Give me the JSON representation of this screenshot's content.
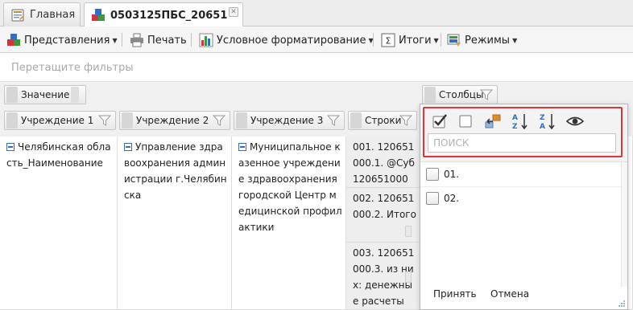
{
  "tabs": [
    {
      "label": "Главная"
    },
    {
      "label": "0503125ПБС_20651"
    }
  ],
  "toolbar": {
    "views": "Представления",
    "print": "Печать",
    "conditional": "Условное форматирование",
    "totals": "Итоги",
    "modes": "Режимы"
  },
  "filter_hint": "Перетащите фильтры",
  "fields": {
    "value": "Значение",
    "columns": "Столбцы",
    "row1": "Учреждение 1",
    "row2": "Учреждение 2",
    "row3": "Учреждение 3",
    "row4": "Строки"
  },
  "cells": {
    "inst1": "Челябинская область_Наименование",
    "inst2": "Управление здравоохранения администрации г.Челябинска",
    "inst3": "Муниципальное казенное учреждение здравоохранения городской Центр медицинской профилактики",
    "row_a": "001. 120651000.1. @Суб120651000",
    "row_b": "002. 120651000.2. Итого",
    "row_c": "003. 120651000.3. из них: денежные расчеты"
  },
  "popup": {
    "search_placeholder": "ПОИСК",
    "options": [
      "01.",
      "02."
    ],
    "apply": "Принять",
    "cancel": "Отмена"
  },
  "colors": {
    "accent_blue": "#3a6ea8",
    "highlight_red": "#d9383b"
  }
}
